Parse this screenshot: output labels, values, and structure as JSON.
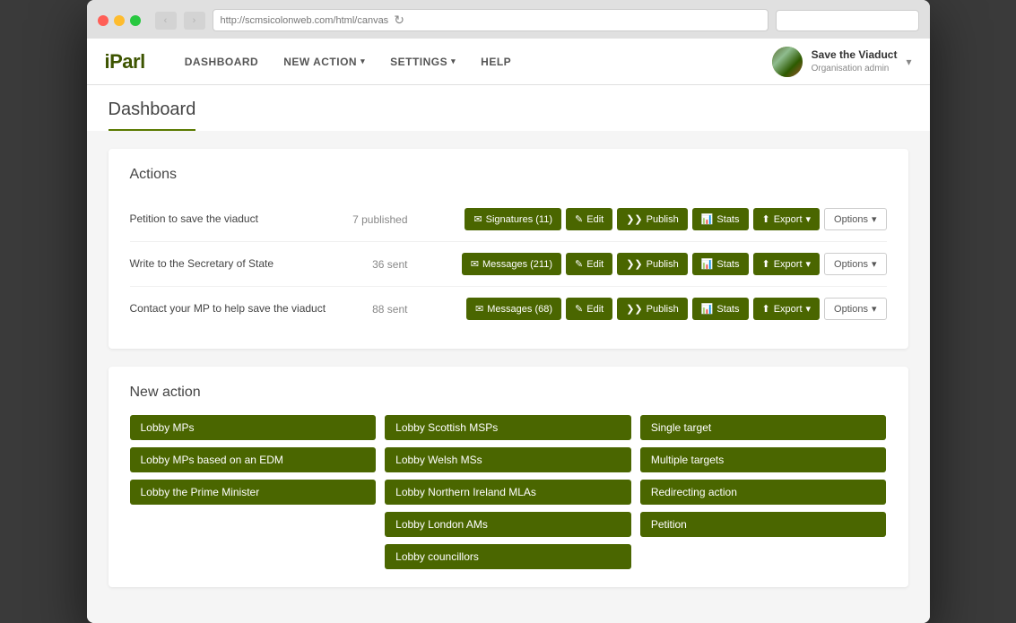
{
  "browser": {
    "url": "http://scmsicolonweb.com/html/canvas",
    "back_disabled": true,
    "forward_disabled": true
  },
  "nav": {
    "logo": "iParl",
    "items": [
      {
        "id": "dashboard",
        "label": "DASHBOARD",
        "has_caret": false
      },
      {
        "id": "new-action",
        "label": "NEW ACTION",
        "has_caret": true
      },
      {
        "id": "settings",
        "label": "SETTINGS",
        "has_caret": true
      },
      {
        "id": "help",
        "label": "HELP",
        "has_caret": false
      }
    ],
    "user": {
      "name": "Save the Viaduct",
      "role": "Organisation admin"
    }
  },
  "page": {
    "title": "Dashboard"
  },
  "actions_section": {
    "title": "Actions",
    "rows": [
      {
        "name": "Petition to save the viaduct",
        "count": "7 published",
        "signatures_label": "Signatures (11)",
        "edit_label": "Edit",
        "publish_label": "Publish",
        "stats_label": "Stats",
        "export_label": "Export",
        "options_label": "Options"
      },
      {
        "name": "Write to the Secretary of State",
        "count": "36 sent",
        "signatures_label": "Messages (211)",
        "edit_label": "Edit",
        "publish_label": "Publish",
        "stats_label": "Stats",
        "export_label": "Export",
        "options_label": "Options"
      },
      {
        "name": "Contact your MP to help save the viaduct",
        "count": "88 sent",
        "signatures_label": "Messages (68)",
        "edit_label": "Edit",
        "publish_label": "Publish",
        "stats_label": "Stats",
        "export_label": "Export",
        "options_label": "Options"
      }
    ]
  },
  "new_action_section": {
    "title": "New action",
    "columns": [
      {
        "id": "col1",
        "buttons": [
          {
            "id": "lobby-mps",
            "label": "Lobby MPs"
          },
          {
            "id": "lobby-mps-edm",
            "label": "Lobby MPs based on an EDM"
          },
          {
            "id": "lobby-pm",
            "label": "Lobby the Prime Minister"
          }
        ]
      },
      {
        "id": "col2",
        "buttons": [
          {
            "id": "lobby-scottish-msps",
            "label": "Lobby Scottish MSPs"
          },
          {
            "id": "lobby-welsh-ms",
            "label": "Lobby Welsh MSs"
          },
          {
            "id": "lobby-ni-mlas",
            "label": "Lobby Northern Ireland MLAs"
          },
          {
            "id": "lobby-london-ams",
            "label": "Lobby London AMs"
          },
          {
            "id": "lobby-councillors",
            "label": "Lobby councillors"
          }
        ]
      },
      {
        "id": "col3",
        "buttons": [
          {
            "id": "single-target",
            "label": "Single target"
          },
          {
            "id": "multiple-targets",
            "label": "Multiple targets"
          },
          {
            "id": "redirecting-action",
            "label": "Redirecting action"
          },
          {
            "id": "petition",
            "label": "Petition"
          }
        ]
      }
    ]
  },
  "icons": {
    "envelope": "✉",
    "edit": "✎",
    "publish": "❯❯",
    "stats": "📊",
    "export": "⬆",
    "caret_down": "▾",
    "back": "‹",
    "forward": "›",
    "refresh": "↻"
  }
}
